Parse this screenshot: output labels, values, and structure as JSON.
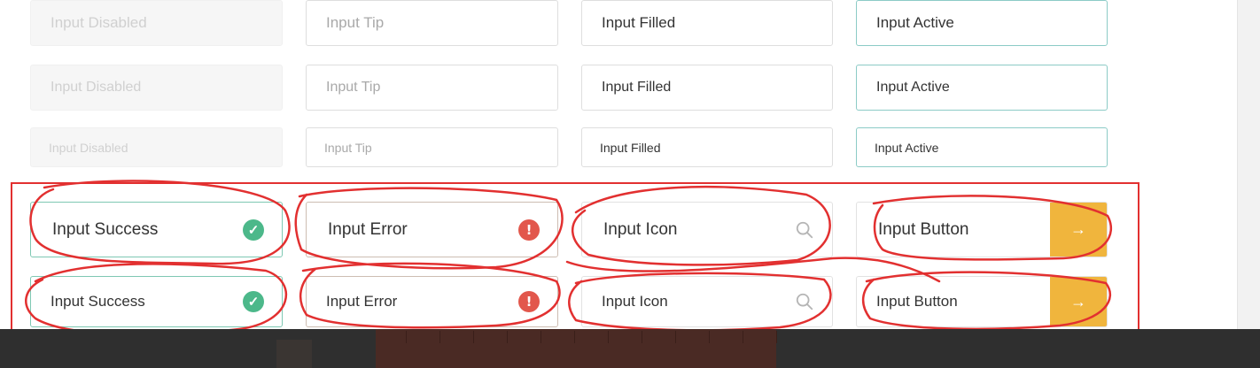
{
  "rows": {
    "row1": {
      "disabled": "Input Disabled",
      "tip": "Input Tip",
      "filled": "Input Filled",
      "active": "Input Active"
    },
    "row2": {
      "disabled": "Input Disabled",
      "tip": "Input Tip",
      "filled": "Input Filled",
      "active": "Input Active"
    },
    "row3": {
      "disabled": "Input Disabled",
      "tip": "Input Tip",
      "filled": "Input Filled",
      "active": "Input Active"
    },
    "row4": {
      "success": "Input Success",
      "error": "Input Error",
      "icon": "Input Icon",
      "button": "Input Button"
    },
    "row5": {
      "success": "Input Success",
      "error": "Input Error",
      "icon": "Input Icon",
      "button": "Input Button"
    }
  },
  "icons": {
    "success": "check-circle-icon",
    "error": "exclamation-circle-icon",
    "search": "search-icon",
    "submit": "arrow-right-icon"
  },
  "glyphs": {
    "check": "✓",
    "exclamation": "!",
    "arrow": "→"
  },
  "colors": {
    "success": "#4cb88a",
    "error": "#e2574c",
    "button": "#f0b53d",
    "active_border": "#8ccbc6",
    "annotation": "#e23030"
  }
}
